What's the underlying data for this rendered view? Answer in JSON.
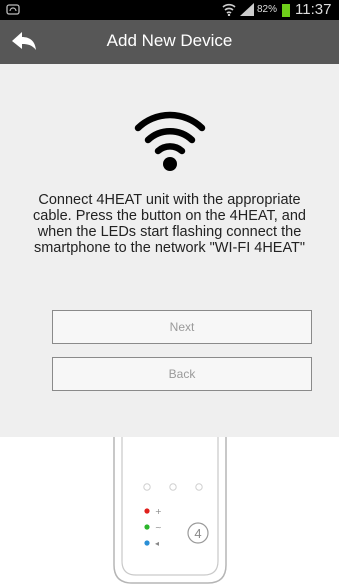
{
  "status_bar": {
    "battery_percent": "82%",
    "time": "11:37",
    "icons": [
      "app-notification-icon",
      "wifi-signal-icon",
      "cell-signal-icon",
      "battery-icon"
    ]
  },
  "header": {
    "title": "Add New Device",
    "back_icon": "back-arrow-icon"
  },
  "main": {
    "instructions": "Connect 4HEAT unit with the appropriate cable. Press the button on the 4HEAT, and when the LEDs start flashing connect the smartphone to the network \"WI-FI 4HEAT\"",
    "next_label": "Next",
    "back_label": "Back"
  },
  "device": {
    "logo": "4"
  },
  "colors": {
    "title_bar": "#575757",
    "content_bg": "#efefef",
    "led_red": "#e0201c",
    "led_green": "#2bb52b",
    "led_blue": "#2a8fd6"
  }
}
